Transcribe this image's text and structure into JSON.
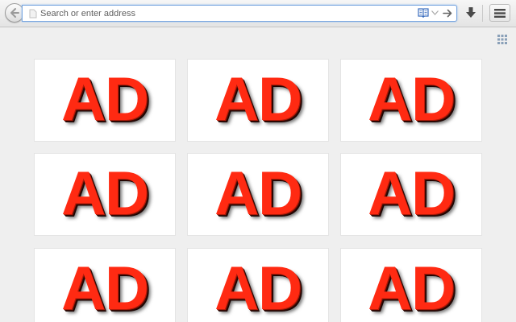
{
  "toolbar": {
    "address_placeholder": "Search or enter address"
  },
  "icons": {
    "back": "back-arrow-icon",
    "site": "page-icon",
    "reader": "reader-view-icon",
    "dropmarker": "dropdown-arrow-icon",
    "go": "go-arrow-icon",
    "download": "download-icon",
    "menu": "hamburger-menu-icon",
    "grid": "grid-toggle-icon"
  },
  "tiles": [
    {
      "label": "AD"
    },
    {
      "label": "AD"
    },
    {
      "label": "AD"
    },
    {
      "label": "AD"
    },
    {
      "label": "AD"
    },
    {
      "label": "AD"
    },
    {
      "label": "AD"
    },
    {
      "label": "AD"
    },
    {
      "label": "AD"
    }
  ],
  "colors": {
    "ad_text": "#ff2a12",
    "page_background": "#efefef",
    "urlbar_focus": "#7aa7e0"
  }
}
